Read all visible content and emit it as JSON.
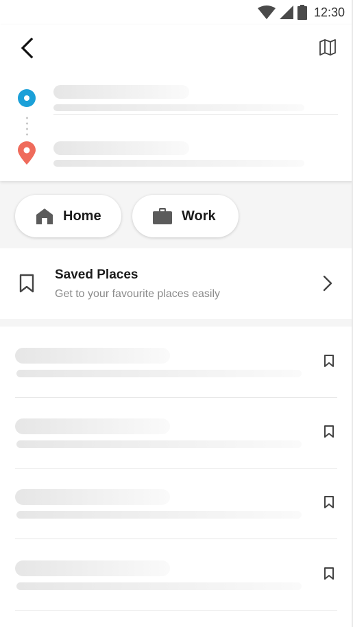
{
  "status_bar": {
    "time": "12:30",
    "icons": [
      "wifi-icon",
      "cell-signal-icon",
      "battery-icon"
    ]
  },
  "header": {
    "back_icon": "back-arrow-icon",
    "map_icon": "map-icon"
  },
  "route": {
    "origin_icon": "origin-dot-icon",
    "destination_icon": "destination-pin-icon"
  },
  "shortcuts": [
    {
      "label": "Home",
      "icon": "home-icon"
    },
    {
      "label": "Work",
      "icon": "briefcase-icon"
    }
  ],
  "saved_places": {
    "title": "Saved Places",
    "subtitle": "Get to your favourite places easily",
    "icon": "bookmark-icon",
    "chevron_icon": "chevron-right-icon"
  },
  "colors": {
    "origin": "#1ba0d8",
    "destination": "#ef6b5b",
    "text": "#1b1b1b",
    "subtext": "#8b8b8b"
  }
}
